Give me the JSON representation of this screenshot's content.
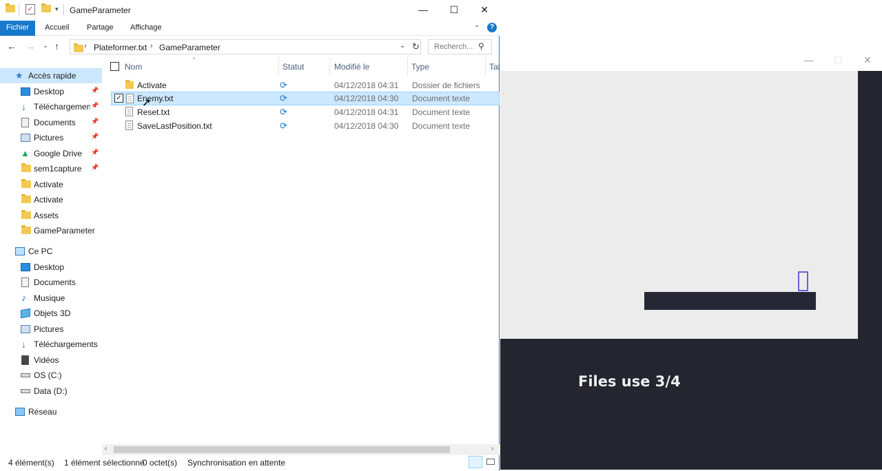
{
  "explorer": {
    "title": "GameParameter",
    "window_controls": {
      "minimize": "—",
      "maximize": "☐",
      "close": "✕"
    },
    "ribbon": {
      "tabs": [
        "Fichier",
        "Accueil",
        "Partage",
        "Affichage"
      ],
      "help": "?"
    },
    "address": {
      "crumbs": [
        "Plateformer.txt",
        "GameParameter"
      ],
      "search_placeholder": "Recherch..."
    },
    "nav": {
      "quick_access": "Accès rapide",
      "quick_items": [
        {
          "label": "Desktop",
          "icon": "desktop-icon",
          "pinned": true
        },
        {
          "label": "Téléchargements",
          "icon": "download-icon",
          "pinned": true
        },
        {
          "label": "Documents",
          "icon": "documents-icon",
          "pinned": true
        },
        {
          "label": "Pictures",
          "icon": "pictures-icon",
          "pinned": true
        },
        {
          "label": "Google Drive",
          "icon": "google-drive-icon",
          "pinned": true
        },
        {
          "label": "sem1capture",
          "icon": "folder-icon",
          "pinned": true
        },
        {
          "label": "Activate",
          "icon": "folder-icon",
          "pinned": false
        },
        {
          "label": "Activate",
          "icon": "folder-icon",
          "pinned": false
        },
        {
          "label": "Assets",
          "icon": "folder-icon",
          "pinned": false
        },
        {
          "label": "GameParameter",
          "icon": "folder-icon",
          "pinned": false
        }
      ],
      "this_pc": "Ce PC",
      "pc_items": [
        {
          "label": "Desktop",
          "icon": "desktop-icon"
        },
        {
          "label": "Documents",
          "icon": "documents-icon"
        },
        {
          "label": "Musique",
          "icon": "music-icon"
        },
        {
          "label": "Objets 3D",
          "icon": "objects-3d-icon"
        },
        {
          "label": "Pictures",
          "icon": "pictures-icon"
        },
        {
          "label": "Téléchargements",
          "icon": "download-icon"
        },
        {
          "label": "Vidéos",
          "icon": "videos-icon"
        },
        {
          "label": "OS (C:)",
          "icon": "os-drive-icon"
        },
        {
          "label": "Data (D:)",
          "icon": "drive-icon"
        }
      ],
      "network": "Réseau"
    },
    "columns": [
      "Nom",
      "Statut",
      "Modifié le",
      "Type",
      "Tai"
    ],
    "files": [
      {
        "name": "Activate",
        "kind": "folder",
        "modified": "04/12/2018 04:31",
        "type": "Dossier de fichiers",
        "selected": false
      },
      {
        "name": "Enemy.txt",
        "kind": "doc",
        "modified": "04/12/2018 04:30",
        "type": "Document texte",
        "selected": true
      },
      {
        "name": "Reset.txt",
        "kind": "doc",
        "modified": "04/12/2018 04:31",
        "type": "Document texte",
        "selected": false
      },
      {
        "name": "SaveLastPosition.txt",
        "kind": "doc",
        "modified": "04/12/2018 04:30",
        "type": "Document texte",
        "selected": false
      }
    ],
    "status": {
      "count": "4 élément(s)",
      "selected": "1 élément sélectionné",
      "size": "0 octet(s)",
      "sync": "Synchronisation en attente"
    }
  },
  "game": {
    "window_controls": {
      "minimize": "—",
      "maximize": "☐",
      "close": "✕"
    },
    "hud_text": "Files use 3/4",
    "colors": {
      "background": "#23252f",
      "canvas": "#ececec",
      "platform": "#252734",
      "player_outline": "#6d5fd8"
    }
  }
}
